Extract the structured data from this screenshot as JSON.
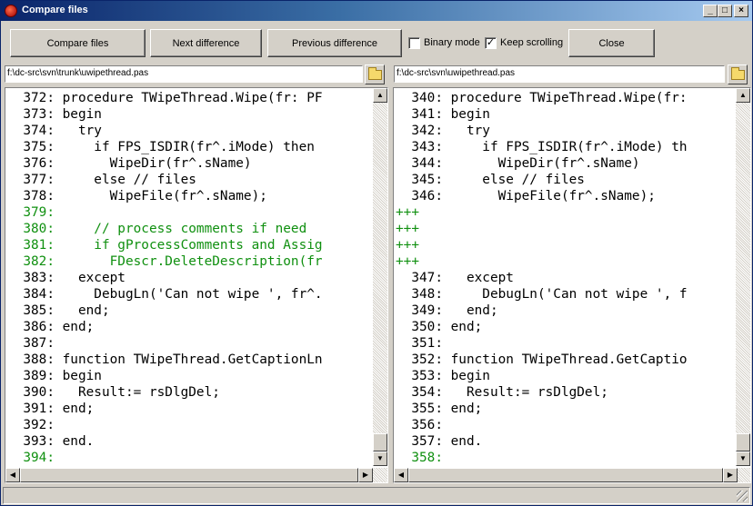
{
  "window": {
    "title": "Compare files"
  },
  "title_buttons": {
    "minimize": "_",
    "maximize": "□",
    "close": "×"
  },
  "toolbar": {
    "compare": "Compare files",
    "next_diff": "Next difference",
    "prev_diff": "Previous difference",
    "binary_mode": "Binary mode",
    "binary_mode_checked": false,
    "keep_scrolling": "Keep scrolling",
    "keep_scrolling_checked": true,
    "close": "Close"
  },
  "left": {
    "path": "f:\\dc-src\\svn\\trunk\\uwipethread.pas",
    "lines": [
      {
        "text": "  372: procedure TWipeThread.Wipe(fr: PF",
        "color": "normal"
      },
      {
        "text": "  373: begin",
        "color": "normal"
      },
      {
        "text": "  374:   try",
        "color": "normal"
      },
      {
        "text": "  375:     if FPS_ISDIR(fr^.iMode) then",
        "color": "normal"
      },
      {
        "text": "  376:       WipeDir(fr^.sName)",
        "color": "normal"
      },
      {
        "text": "  377:     else // files",
        "color": "normal"
      },
      {
        "text": "  378:       WipeFile(fr^.sName);",
        "color": "normal"
      },
      {
        "text": "  379:",
        "color": "green"
      },
      {
        "text": "  380:     // process comments if need",
        "color": "green"
      },
      {
        "text": "  381:     if gProcessComments and Assig",
        "color": "green"
      },
      {
        "text": "  382:       FDescr.DeleteDescription(fr",
        "color": "green"
      },
      {
        "text": "  383:   except",
        "color": "normal"
      },
      {
        "text": "  384:     DebugLn('Can not wipe ', fr^.",
        "color": "normal"
      },
      {
        "text": "  385:   end;",
        "color": "normal"
      },
      {
        "text": "  386: end;",
        "color": "normal"
      },
      {
        "text": "  387:",
        "color": "normal"
      },
      {
        "text": "  388: function TWipeThread.GetCaptionLn",
        "color": "normal"
      },
      {
        "text": "  389: begin",
        "color": "normal"
      },
      {
        "text": "  390:   Result:= rsDlgDel;",
        "color": "normal"
      },
      {
        "text": "  391: end;",
        "color": "normal"
      },
      {
        "text": "  392:",
        "color": "normal"
      },
      {
        "text": "  393: end.",
        "color": "normal"
      },
      {
        "text": "  394:",
        "color": "green"
      }
    ]
  },
  "right": {
    "path": "f:\\dc-src\\svn\\uwipethread.pas",
    "lines": [
      {
        "text": "  340: procedure TWipeThread.Wipe(fr:",
        "color": "normal"
      },
      {
        "text": "  341: begin",
        "color": "normal"
      },
      {
        "text": "  342:   try",
        "color": "normal"
      },
      {
        "text": "  343:     if FPS_ISDIR(fr^.iMode) th",
        "color": "normal"
      },
      {
        "text": "  344:       WipeDir(fr^.sName)",
        "color": "normal"
      },
      {
        "text": "  345:     else // files",
        "color": "normal"
      },
      {
        "text": "  346:       WipeFile(fr^.sName);",
        "color": "normal"
      },
      {
        "text": "+++",
        "color": "green"
      },
      {
        "text": "+++",
        "color": "green"
      },
      {
        "text": "+++",
        "color": "green"
      },
      {
        "text": "+++",
        "color": "green"
      },
      {
        "text": "  347:   except",
        "color": "normal"
      },
      {
        "text": "  348:     DebugLn('Can not wipe ', f",
        "color": "normal"
      },
      {
        "text": "  349:   end;",
        "color": "normal"
      },
      {
        "text": "  350: end;",
        "color": "normal"
      },
      {
        "text": "  351:",
        "color": "normal"
      },
      {
        "text": "  352: function TWipeThread.GetCaptio",
        "color": "normal"
      },
      {
        "text": "  353: begin",
        "color": "normal"
      },
      {
        "text": "  354:   Result:= rsDlgDel;",
        "color": "normal"
      },
      {
        "text": "  355: end;",
        "color": "normal"
      },
      {
        "text": "  356:",
        "color": "normal"
      },
      {
        "text": "  357: end.",
        "color": "normal"
      },
      {
        "text": "  358:",
        "color": "green"
      }
    ]
  },
  "colors": {
    "normal": "#000000",
    "green": "#109010"
  },
  "scroll_arrows": {
    "up": "▲",
    "down": "▼",
    "left": "◀",
    "right": "▶"
  }
}
